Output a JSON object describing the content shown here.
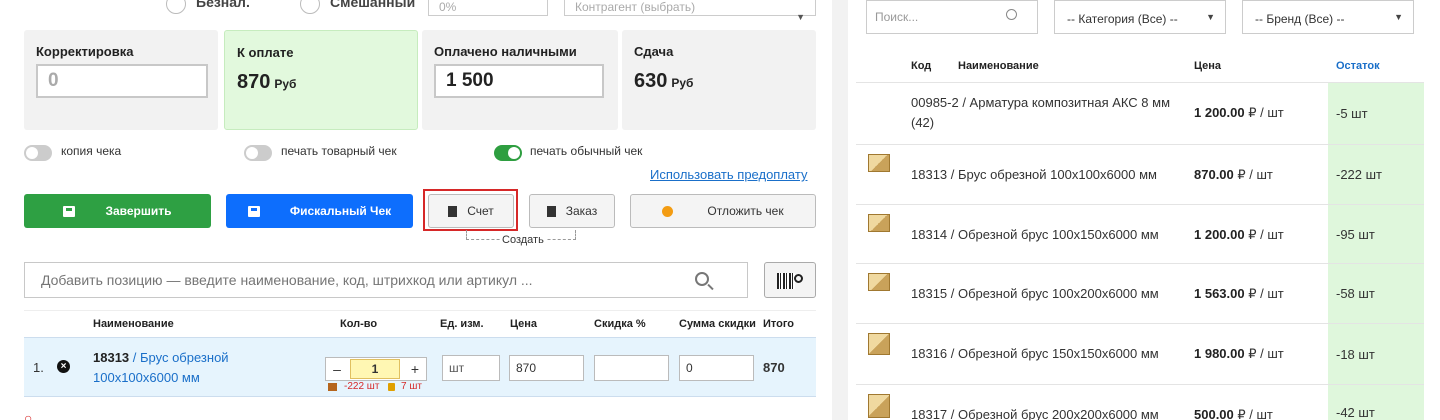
{
  "payment": {
    "radio1_label": "Безнал.",
    "radio2_label": "Смешанный",
    "percent_value": "0%",
    "counterparty_placeholder": "Контрагент (выбрать)"
  },
  "cards": {
    "correction_title": "Корректировка",
    "correction_value": "0",
    "topay_title": "К оплате",
    "topay_value": "870",
    "topay_unit": "Руб",
    "cash_title": "Оплачено наличными",
    "cash_value": "1 500",
    "change_title": "Сдача",
    "change_value": "630",
    "change_unit": "Руб"
  },
  "toggles": {
    "copy_label": "копия чека",
    "goods_label": "печать товарный чек",
    "regular_label": "печать обычный чек"
  },
  "prepay_link": "Использовать предоплату",
  "buttons": {
    "finish": "Завершить",
    "fiscal": "Фискальный Чек",
    "invoice": "Счет",
    "order": "Заказ",
    "postpone": "Отложить чек",
    "create_caption": "Создать"
  },
  "add_search": {
    "placeholder": "Добавить позицию — введите наименование, код, штрихкод или артикул ..."
  },
  "cart": {
    "headers": [
      "Наименование",
      "Кол-во",
      "Ед. изм.",
      "Цена",
      "Скидка %",
      "Сумма скидки",
      "Итого"
    ],
    "row": {
      "num": "1.",
      "code": "18313",
      "name_part1": " / Брус обрезной",
      "name_part2": "100x100x6000 мм",
      "qty": "1",
      "unit": "шт",
      "price": "870",
      "discount_pct": "",
      "discount_sum": "0",
      "total": "870",
      "stock_note": "-222 шт",
      "reserve_note": "7 шт"
    }
  },
  "catalog": {
    "search_placeholder": "Поиск...",
    "category_select": "-- Категория (Все) --",
    "brand_select": "-- Бренд (Все) --",
    "headers": {
      "code": "Код",
      "name": "Наименование",
      "price": "Цена",
      "stock": "Остаток"
    },
    "rows": [
      {
        "name": "00985-2 / Арматура композитная АКС 8 мм (42)",
        "price": "1 200.00",
        "unit": " ₽ / шт",
        "stock": "-5 шт"
      },
      {
        "name": "18313 / Брус обрезной 100x100x6000 мм",
        "price": "870.00",
        "unit": " ₽ / шт",
        "stock": "-222 шт"
      },
      {
        "name": "18314 / Обрезной брус 100x150x6000 мм",
        "price": "1 200.00",
        "unit": " ₽ / шт",
        "stock": "-95 шт"
      },
      {
        "name": "18315 / Обрезной брус 100x200x6000 мм",
        "price": "1 563.00",
        "unit": " ₽ / шт",
        "stock": "-58 шт"
      },
      {
        "name": "18316 / Обрезной брус 150x150x6000 мм",
        "price": "1 980.00",
        "unit": " ₽ / шт",
        "stock": "-18 шт"
      },
      {
        "name": "18317 / Обрезной брус 200x200x6000 мм",
        "price": "500.00",
        "unit": " ₽ / шт",
        "stock": "-42 шт"
      }
    ]
  },
  "colors": {
    "green": "#2ea043",
    "blue": "#0d6efd",
    "link": "#1a6fc9",
    "highlight_border": "#d62828",
    "stock_bg": "#dff7dc"
  }
}
